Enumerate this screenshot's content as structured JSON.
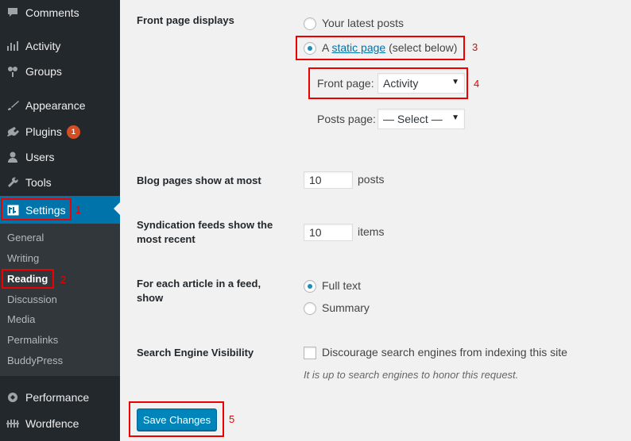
{
  "sidebar": {
    "items": [
      {
        "label": "Comments",
        "icon": "comment-icon"
      },
      {
        "label": "Activity",
        "icon": "activity-icon"
      },
      {
        "label": "Groups",
        "icon": "groups-icon"
      },
      {
        "label": "Appearance",
        "icon": "paintbrush-icon"
      },
      {
        "label": "Plugins",
        "icon": "plugin-icon",
        "badge": "1"
      },
      {
        "label": "Users",
        "icon": "user-icon"
      },
      {
        "label": "Tools",
        "icon": "wrench-icon"
      },
      {
        "label": "Settings",
        "icon": "settings-icon"
      },
      {
        "label": "Performance",
        "icon": "performance-icon"
      },
      {
        "label": "Wordfence",
        "icon": "wordfence-icon"
      }
    ],
    "submenu": [
      "General",
      "Writing",
      "Reading",
      "Discussion",
      "Media",
      "Permalinks",
      "BuddyPress"
    ]
  },
  "front_page": {
    "label": "Front page displays",
    "option_latest": "Your latest posts",
    "option_static_prefix": "A ",
    "option_static_link": "static page",
    "option_static_suffix": " (select below)",
    "front_page_label": "Front page:",
    "front_page_value": "Activity",
    "posts_page_label": "Posts page:",
    "posts_page_value": "— Select —"
  },
  "blog_pages": {
    "label": "Blog pages show at most",
    "value": "10",
    "unit": "posts"
  },
  "syndication": {
    "label": "Syndication feeds show the most recent",
    "value": "10",
    "unit": "items"
  },
  "feed_article": {
    "label": "For each article in a feed, show",
    "option_full": "Full text",
    "option_summary": "Summary"
  },
  "search_engine": {
    "label": "Search Engine Visibility",
    "checkbox_label": "Discourage search engines from indexing this site",
    "description": "It is up to search engines to honor this request."
  },
  "save_button": "Save Changes",
  "annotations": [
    "1",
    "2",
    "3",
    "4",
    "5"
  ],
  "colors": {
    "sidebar_bg": "#23282d",
    "accent": "#0073aa",
    "annotation": "#e00000",
    "badge": "#d54e21"
  }
}
